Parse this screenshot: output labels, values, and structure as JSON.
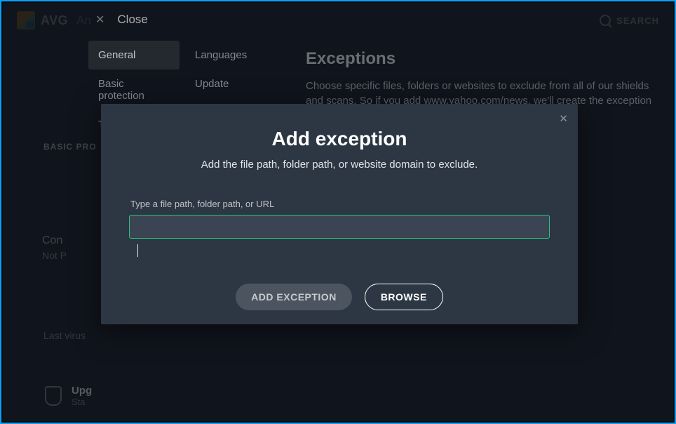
{
  "brand": {
    "name": "AVG",
    "product_fragment": "An"
  },
  "topbar": {
    "search_label": "SEARCH"
  },
  "settings": {
    "close_label": "Close",
    "nav_col1": [
      "General",
      "Basic protection",
      "T"
    ],
    "nav_col2": [
      "Languages",
      "Update"
    ],
    "active_nav_index": 0,
    "page_title": "Exceptions",
    "page_desc": "Choose specific files, folders or websites to exclude from all of our shields and scans. So if you add www.yahoo.com/news, we'll create the exception for all"
  },
  "background": {
    "section_label": "BASIC PRO",
    "tile_name_fragment": "Con",
    "tile_sub_fragment": "Not P",
    "last_scan_fragment": "Last virus",
    "upgrade_title_fragment": "Upg",
    "upgrade_sub_fragment": "Sta"
  },
  "modal": {
    "title": "Add exception",
    "subtitle": "Add the file path, folder path, or website domain to exclude.",
    "field_label": "Type a file path, folder path, or URL",
    "input_value": "",
    "add_button": "ADD EXCEPTION",
    "browse_button": "BROWSE"
  }
}
